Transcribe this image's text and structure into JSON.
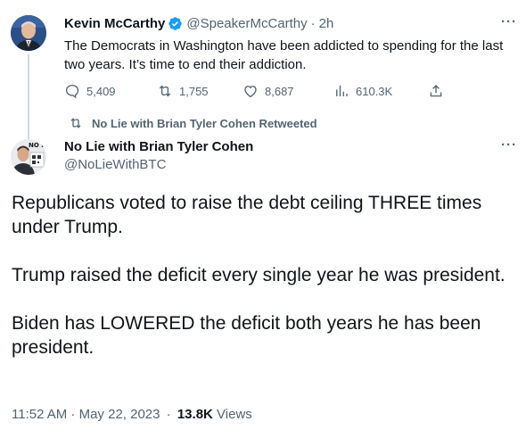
{
  "original_tweet": {
    "author_name": "Kevin McCarthy",
    "handle": "@SpeakerMcCarthy",
    "separator": "·",
    "time_ago": "2h",
    "text": "The Democrats in Washington have been addicted to spending for the last two years. It’s time to end their addiction.",
    "more_label": "···",
    "stats": {
      "replies": "5,409",
      "retweets": "1,755",
      "likes": "8,687",
      "views": "610.3K"
    },
    "verified_color": "#1d9bf0"
  },
  "retweet_bar": {
    "label": "No Lie with Brian Tyler Cohen Retweeted"
  },
  "main_tweet": {
    "author_name": "No Lie with Brian Tyler Cohen",
    "handle": "@NoLieWithBTC",
    "more_label": "···",
    "avatar_text": "NO LIE",
    "paragraphs": [
      "Republicans voted to raise the debt ceiling THREE times under Trump.",
      "Trump raised the deficit every single year he was president.",
      "Biden has LOWERED the deficit both years he has been president."
    ],
    "timestamp": "11:52 AM · May 22, 2023",
    "dot": "·",
    "views_count": "13.8K",
    "views_label": "Views"
  }
}
